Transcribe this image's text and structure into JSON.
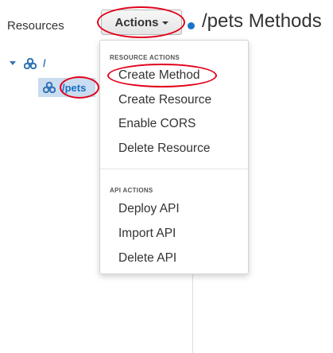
{
  "sidebar": {
    "title": "Resources",
    "tree": {
      "root_label": "/",
      "child_label": "/pets"
    }
  },
  "toolbar": {
    "actions_label": "Actions"
  },
  "header": {
    "title": "/pets Methods"
  },
  "menu": {
    "resource_section_label": "RESOURCE ACTIONS",
    "resource_items": [
      "Create Method",
      "Create Resource",
      "Enable CORS",
      "Delete Resource"
    ],
    "api_section_label": "API ACTIONS",
    "api_items": [
      "Deploy API",
      "Import API",
      "Delete API"
    ]
  },
  "colors": {
    "highlight_ring": "#e2001a",
    "method_dot": "#1a75c8",
    "selected_row_bg": "#c9dcf0",
    "link_blue": "#1a6fc4"
  },
  "icons": {
    "tree_node": "resource-cluster-icon",
    "tree_expand": "caret-down-icon",
    "actions_dropdown": "caret-down-icon"
  }
}
